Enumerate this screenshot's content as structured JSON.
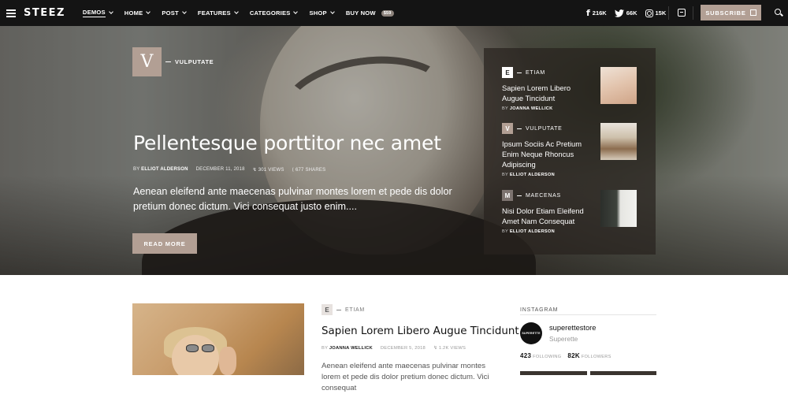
{
  "brand": "STEEZ",
  "nav": {
    "menu": [
      {
        "label": "DEMOS",
        "active": true,
        "caret": true
      },
      {
        "label": "HOME",
        "caret": true
      },
      {
        "label": "POST",
        "caret": true
      },
      {
        "label": "FEATURES",
        "caret": true
      },
      {
        "label": "CATEGORIES",
        "caret": true
      },
      {
        "label": "SHOP",
        "caret": true
      },
      {
        "label": "BUY NOW",
        "caret": false
      }
    ],
    "buy_badge": "$59",
    "social": {
      "facebook": "216K",
      "twitter": "66K",
      "instagram": "15K"
    },
    "subscribe": "SUBSCRIBE"
  },
  "hero": {
    "category_letter": "V",
    "category": "VULPUTATE",
    "title": "Pellentesque porttitor nec amet",
    "by": "BY",
    "author": "ELLIOT ALDERSON",
    "date": "DECEMBER 11, 2018",
    "views": "301 VIEWS",
    "shares": "677 SHARES",
    "excerpt": "Aenean eleifend ante maecenas pulvinar montes lorem et pede dis dolor pretium donec dictum. Vici consequat justo enim....",
    "read_more": "READ MORE"
  },
  "side_posts": [
    {
      "letter": "E",
      "category": "ETIAM",
      "title": "Sapien Lorem Libero Augue Tincidunt",
      "by": "BY",
      "author": "JOANNA WELLICK"
    },
    {
      "letter": "V",
      "category": "VULPUTATE",
      "title": "Ipsum Sociis Ac Pretium Enim Neque Rhoncus Adipiscing",
      "by": "BY",
      "author": "ELLIOT ALDERSON"
    },
    {
      "letter": "M",
      "category": "MAECENAS",
      "title": "Nisi Dolor Etiam Eleifend Amet Nam Consequat",
      "by": "BY",
      "author": "ELLIOT ALDERSON"
    }
  ],
  "post2": {
    "letter": "E",
    "category": "ETIAM",
    "title": "Sapien Lorem Libero Augue Tincidunt",
    "by": "BY",
    "author": "JOANNA WELLICK",
    "date": "DECEMBER 5, 2018",
    "views": "1.2K VIEWS",
    "excerpt": "Aenean eleifend ante maecenas pulvinar montes lorem et pede dis dolor pretium donec dictum. Vici consequat"
  },
  "instagram": {
    "heading": "INSTAGRAM",
    "avatar_text": "SUPERETTE",
    "username": "superettestore",
    "name": "Superette",
    "following_count": "423",
    "following_label": "FOLLOWING",
    "followers_count": "82K",
    "followers_label": "FOLLOWERS"
  },
  "colors": {
    "accent": "#b29f94",
    "nav_bg": "#141414"
  }
}
